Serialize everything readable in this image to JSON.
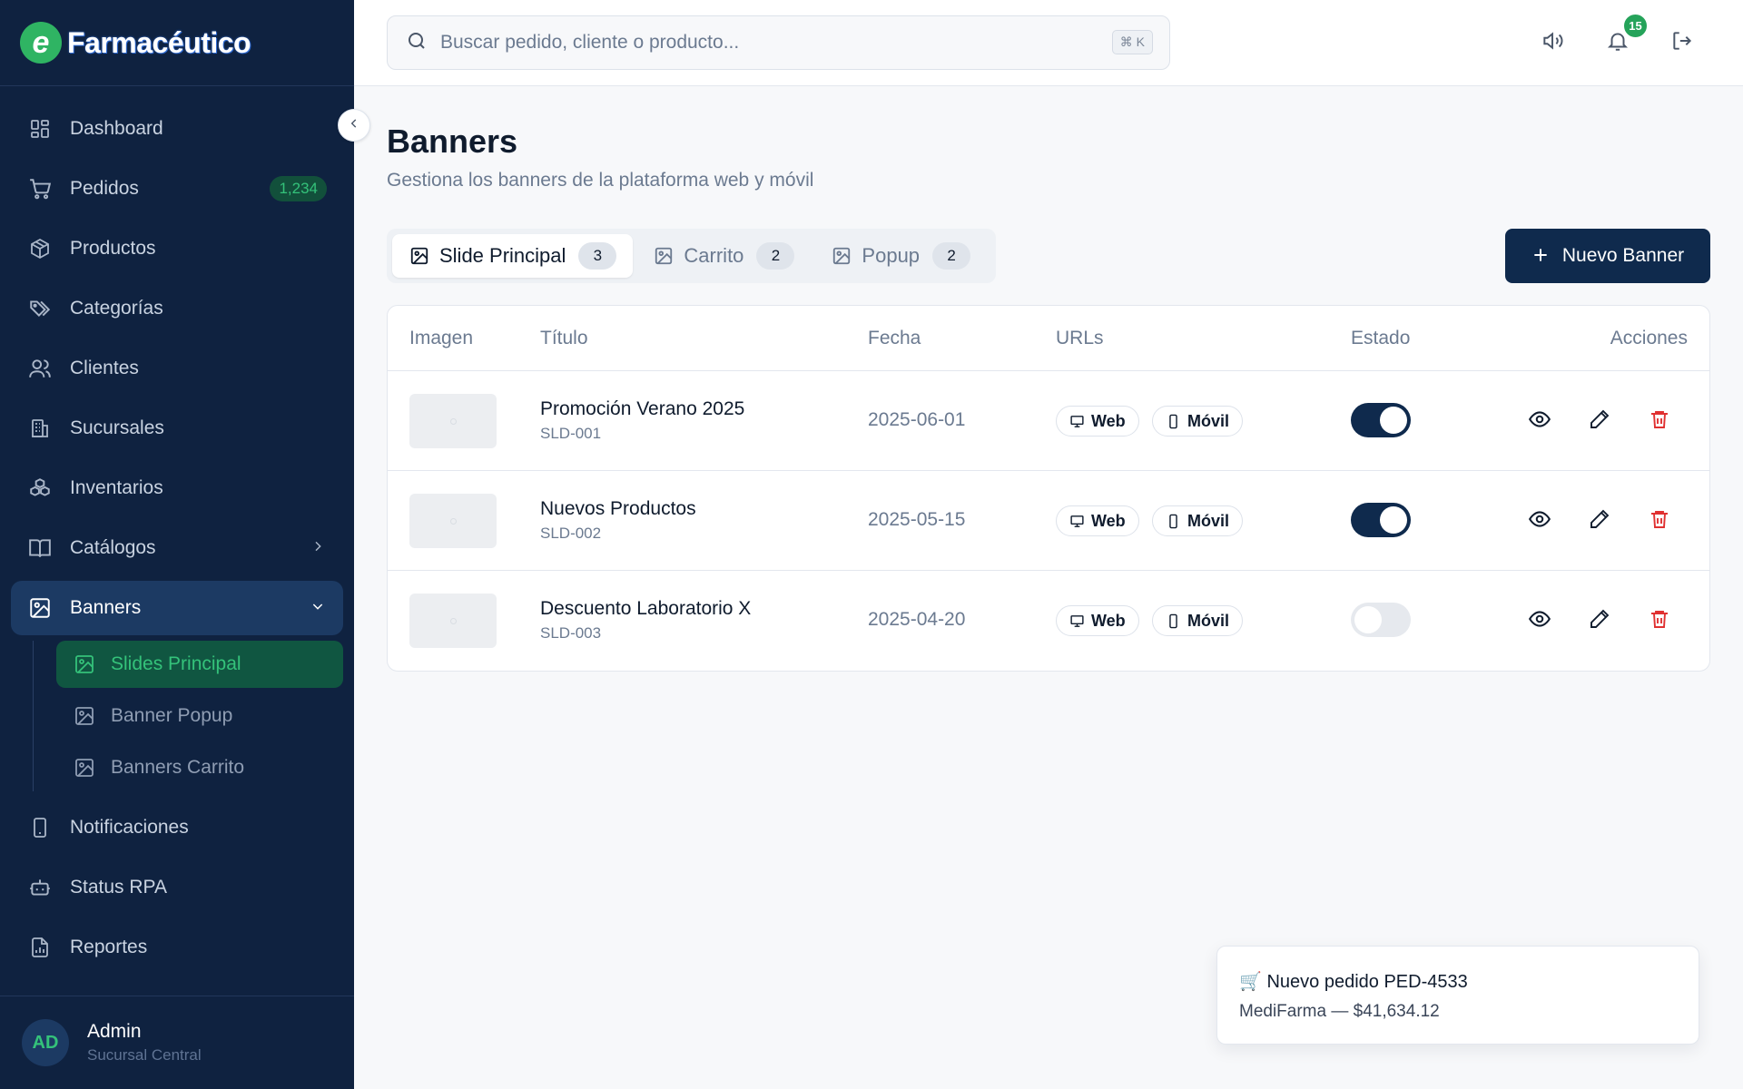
{
  "brand": {
    "logo_letter": "e",
    "name": "Farmacéutico"
  },
  "sidebar": {
    "items": [
      {
        "label": "Dashboard",
        "icon": "dashboard-icon"
      },
      {
        "label": "Pedidos",
        "icon": "cart-icon",
        "badge": "1,234"
      },
      {
        "label": "Productos",
        "icon": "box-icon"
      },
      {
        "label": "Categorías",
        "icon": "tags-icon"
      },
      {
        "label": "Clientes",
        "icon": "users-icon"
      },
      {
        "label": "Sucursales",
        "icon": "building-icon"
      },
      {
        "label": "Inventarios",
        "icon": "boxes-icon"
      },
      {
        "label": "Catálogos",
        "icon": "book-icon"
      },
      {
        "label": "Banners",
        "icon": "image-icon"
      },
      {
        "label": "Notificaciones",
        "icon": "phone-icon"
      },
      {
        "label": "Status RPA",
        "icon": "bot-icon"
      },
      {
        "label": "Reportes",
        "icon": "report-icon"
      }
    ],
    "sub_items": [
      {
        "label": "Slides Principal"
      },
      {
        "label": "Banner Popup"
      },
      {
        "label": "Banners Carrito"
      }
    ],
    "user": {
      "initials": "AD",
      "name": "Admin",
      "branch": "Sucursal Central"
    }
  },
  "topbar": {
    "search_placeholder": "Buscar pedido, cliente o producto...",
    "shortcut": "⌘ K",
    "notification_count": "15"
  },
  "page": {
    "title": "Banners",
    "subtitle": "Gestiona los banners de la plataforma web y móvil",
    "new_button": "Nuevo Banner"
  },
  "tabs": [
    {
      "label": "Slide Principal",
      "count": "3"
    },
    {
      "label": "Carrito",
      "count": "2"
    },
    {
      "label": "Popup",
      "count": "2"
    }
  ],
  "table": {
    "headers": {
      "image": "Imagen",
      "title": "Título",
      "date": "Fecha",
      "urls": "URLs",
      "status": "Estado",
      "actions": "Acciones"
    },
    "url_labels": {
      "web": "Web",
      "mobile": "Móvil"
    },
    "rows": [
      {
        "title": "Promoción Verano 2025",
        "code": "SLD-001",
        "date": "2025-06-01",
        "active": true
      },
      {
        "title": "Nuevos Productos",
        "code": "SLD-002",
        "date": "2025-05-15",
        "active": true
      },
      {
        "title": "Descuento Laboratorio X",
        "code": "SLD-003",
        "date": "2025-04-20",
        "active": false
      }
    ]
  },
  "toast": {
    "title": "🛒 Nuevo pedido PED-4533",
    "body": "MediFarma — $41,634.12"
  },
  "colors": {
    "sidebar_bg": "#0f2240",
    "accent_green": "#34c27a",
    "primary": "#0f2a4d",
    "danger": "#e03131"
  }
}
